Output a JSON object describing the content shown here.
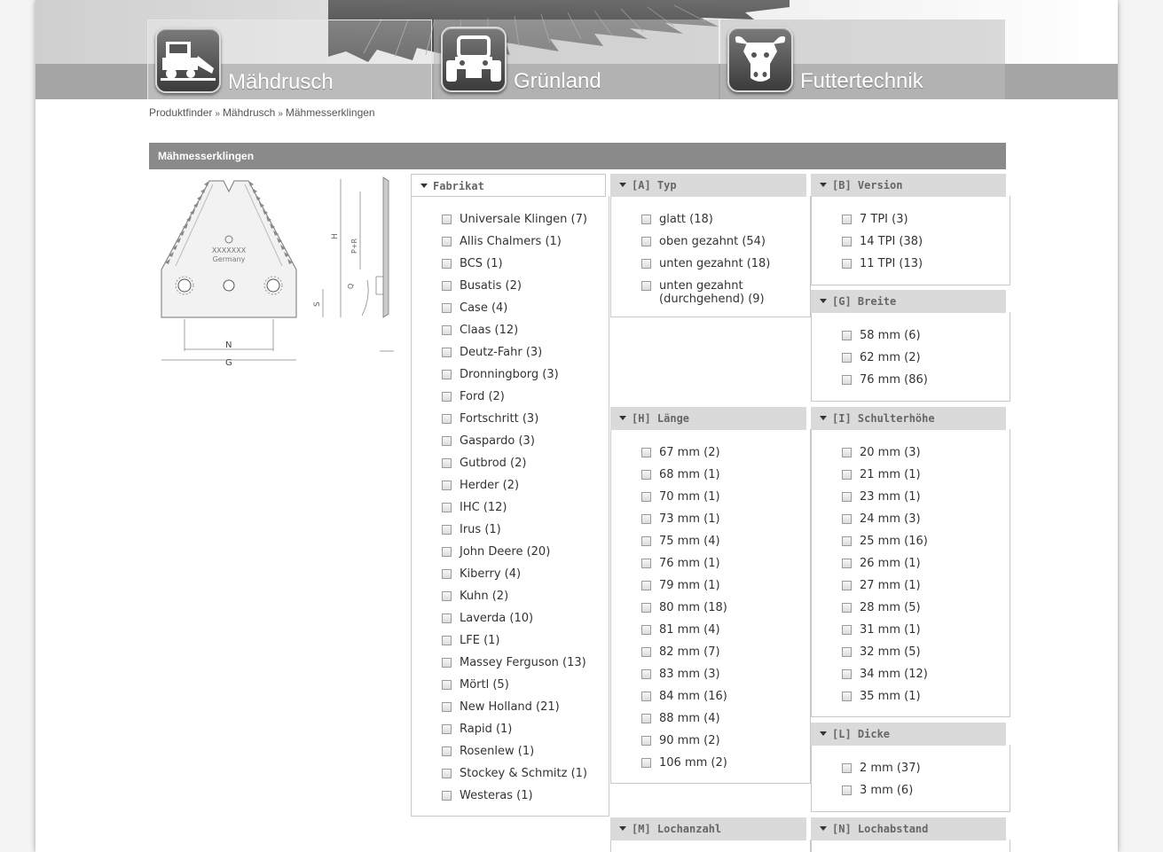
{
  "nav": {
    "tabs": [
      {
        "label": "Mähdrusch",
        "icon": "combine-harvester-icon"
      },
      {
        "label": "Grünland",
        "icon": "tractor-icon"
      },
      {
        "label": "Futtertechnik",
        "icon": "cow-icon"
      }
    ]
  },
  "breadcrumb": {
    "items": [
      "Produktfinder",
      "Mähdrusch",
      "Mähmesserklingen"
    ],
    "separator": "»"
  },
  "page": {
    "title": "Mähmesserklingen"
  },
  "product_image": {
    "stamp_line1": "XXXXXXX",
    "stamp_line2": "Germany",
    "dim_h": "H",
    "dim_pr": "P+R",
    "dim_q": "Q",
    "dim_s": "S",
    "dim_n": "N",
    "dim_g": "G"
  },
  "filters": {
    "fabrikat": {
      "label": "Fabrikat",
      "options": [
        "Universale Klingen (7)",
        "Allis Chalmers (1)",
        "BCS (1)",
        "Busatis (2)",
        "Case (4)",
        "Claas (12)",
        "Deutz-Fahr (3)",
        "Dronningborg (3)",
        "Ford (2)",
        "Fortschritt (3)",
        "Gaspardo (3)",
        "Gutbrod (2)",
        "Herder (2)",
        "IHC (12)",
        "Irus (1)",
        "John Deere (20)",
        "Kiberry (4)",
        "Kuhn (2)",
        "Laverda (10)",
        "LFE (1)",
        "Massey Ferguson (13)",
        "Mörtl (5)",
        "New Holland (21)",
        "Rapid (1)",
        "Rosenlew (1)",
        "Stockey & Schmitz (1)",
        "Westeras (1)"
      ]
    },
    "typ": {
      "label": "[A] Typ",
      "options": [
        "glatt (18)",
        "oben gezahnt (54)",
        "unten gezahnt (18)"
      ],
      "option4_line1": "unten gezahnt",
      "option4_line2": "(durchgehend) (9)"
    },
    "version": {
      "label": "[B] Version",
      "options": [
        "7 TPI (3)",
        "14 TPI (38)",
        "11 TPI (13)"
      ]
    },
    "breite": {
      "label": "[G] Breite",
      "options": [
        "58 mm (6)",
        "62 mm (2)",
        "76 mm (86)"
      ]
    },
    "laenge": {
      "label": "[H] Länge",
      "options": [
        "67 mm (2)",
        "68 mm (1)",
        "70 mm (1)",
        "73 mm (1)",
        "75 mm (4)",
        "76 mm (1)",
        "79 mm (1)",
        "80 mm (18)",
        "81 mm (4)",
        "82 mm (7)",
        "83 mm (3)",
        "84 mm (16)",
        "88 mm (4)",
        "90 mm (2)",
        "106 mm (2)"
      ]
    },
    "schulterhoehe": {
      "label": "[I] Schulterhöhe",
      "options": [
        "20 mm (3)",
        "21 mm (1)",
        "23 mm (1)",
        "24 mm (3)",
        "25 mm (16)",
        "26 mm (1)",
        "27 mm (1)",
        "28 mm (5)",
        "31 mm (1)",
        "32 mm (5)",
        "34 mm (12)",
        "35 mm (1)"
      ]
    },
    "dicke": {
      "label": "[L] Dicke",
      "options": [
        "2 mm (37)",
        "3 mm (6)"
      ]
    },
    "lochanzahl": {
      "label": "[M] Lochanzahl"
    },
    "lochabstand": {
      "label": "[N] Lochabstand"
    }
  }
}
